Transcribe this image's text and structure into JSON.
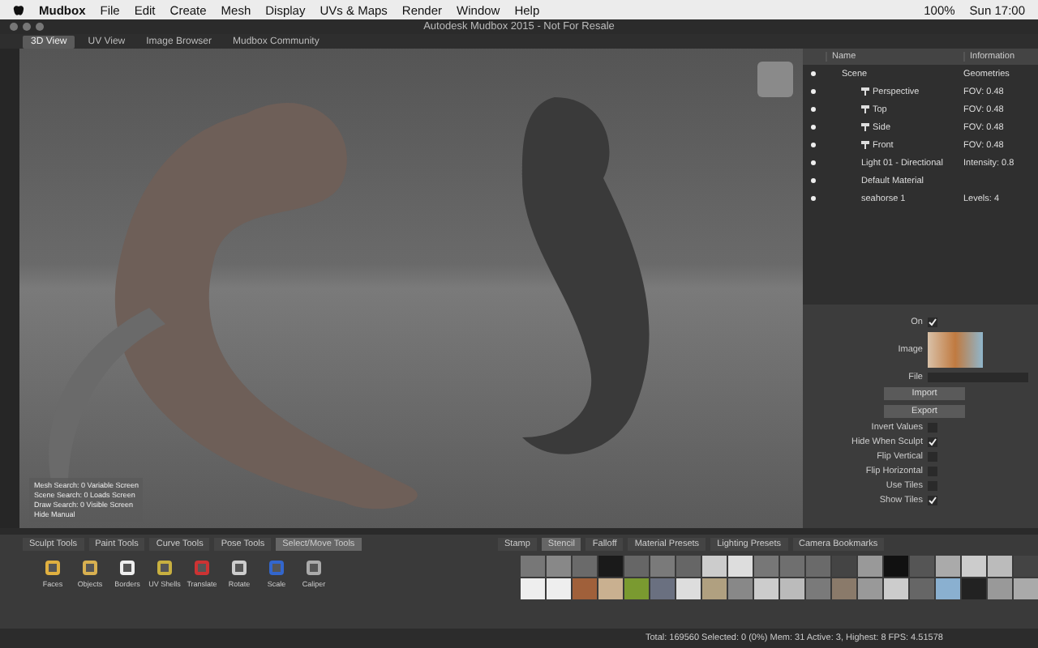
{
  "menu_bar": {
    "app": "Mudbox",
    "items": [
      "File",
      "Edit",
      "Create",
      "Mesh",
      "Display",
      "UVs & Maps",
      "Render",
      "Window",
      "Help"
    ],
    "battery": "100%",
    "clock": "Sun 17:00"
  },
  "window": {
    "title": "Autodesk Mudbox 2015 - Not For Resale"
  },
  "view_tabs": [
    {
      "label": "3D View",
      "selected": true
    },
    {
      "label": "UV View",
      "selected": false
    },
    {
      "label": "Image Browser",
      "selected": false
    },
    {
      "label": "Mudbox Community",
      "selected": false
    }
  ],
  "hud": {
    "lines": [
      {
        "label": "Mesh Search:",
        "value": "0 Variable Screen"
      },
      {
        "label": "Scene Search:",
        "value": "0 Loads Screen"
      },
      {
        "label": "Draw Search:",
        "value": "0 Visible Screen"
      }
    ],
    "toggle": "Hide Manual"
  },
  "object_list": {
    "columns": [
      "Name",
      "Information"
    ],
    "rows": [
      {
        "name": "Scene",
        "info": "Geometries",
        "camera": false,
        "visible": true,
        "children": [
          {
            "name": "Perspective",
            "info": "FOV: 0.48",
            "camera": true,
            "visible": true
          },
          {
            "name": "Top",
            "info": "FOV: 0.48",
            "camera": true,
            "visible": true
          },
          {
            "name": "Side",
            "info": "FOV: 0.48",
            "camera": true,
            "visible": true
          },
          {
            "name": "Front",
            "info": "FOV: 0.48",
            "camera": true,
            "visible": true
          },
          {
            "name": "Light 01 - Directional",
            "info": "Intensity: 0.8",
            "camera": false,
            "visible": true
          },
          {
            "name": "Default Material",
            "camera": false,
            "visible": true
          },
          {
            "name": "seahorse 1",
            "info": "Levels: 4",
            "camera": false,
            "visible": true
          }
        ]
      }
    ]
  },
  "properties": {
    "on": {
      "label": "On",
      "checked": true
    },
    "image_label": "Image",
    "file_label": "File",
    "import": "Import",
    "export": "Export",
    "options": [
      {
        "label": "Invert Values",
        "checked": false
      },
      {
        "label": "Hide When Sculpt",
        "checked": true
      },
      {
        "label": "Flip Vertical",
        "checked": false
      },
      {
        "label": "Flip Horizontal",
        "checked": false
      },
      {
        "label": "Use Tiles",
        "checked": false
      },
      {
        "label": "Show Tiles",
        "checked": true
      }
    ]
  },
  "tool_tabs": [
    {
      "label": "Sculpt Tools",
      "selected": false
    },
    {
      "label": "Paint Tools",
      "selected": false
    },
    {
      "label": "Curve Tools",
      "selected": false
    },
    {
      "label": "Pose Tools",
      "selected": false
    },
    {
      "label": "Select/Move Tools",
      "selected": true
    }
  ],
  "tools": [
    "Faces",
    "Objects",
    "Borders",
    "UV Shells",
    "Translate",
    "Rotate",
    "Scale",
    "Caliper"
  ],
  "tray_tabs": [
    {
      "label": "Stamp",
      "selected": false
    },
    {
      "label": "Stencil",
      "selected": true
    },
    {
      "label": "Falloff",
      "selected": false
    },
    {
      "label": "Material Presets",
      "selected": false
    },
    {
      "label": "Lighting Presets",
      "selected": false
    },
    {
      "label": "Camera Bookmarks",
      "selected": false
    }
  ],
  "status_bar": "Total: 169560  Selected: 0 (0%)  Mem: 31  Active: 3, Highest: 8  FPS: 4.51578"
}
